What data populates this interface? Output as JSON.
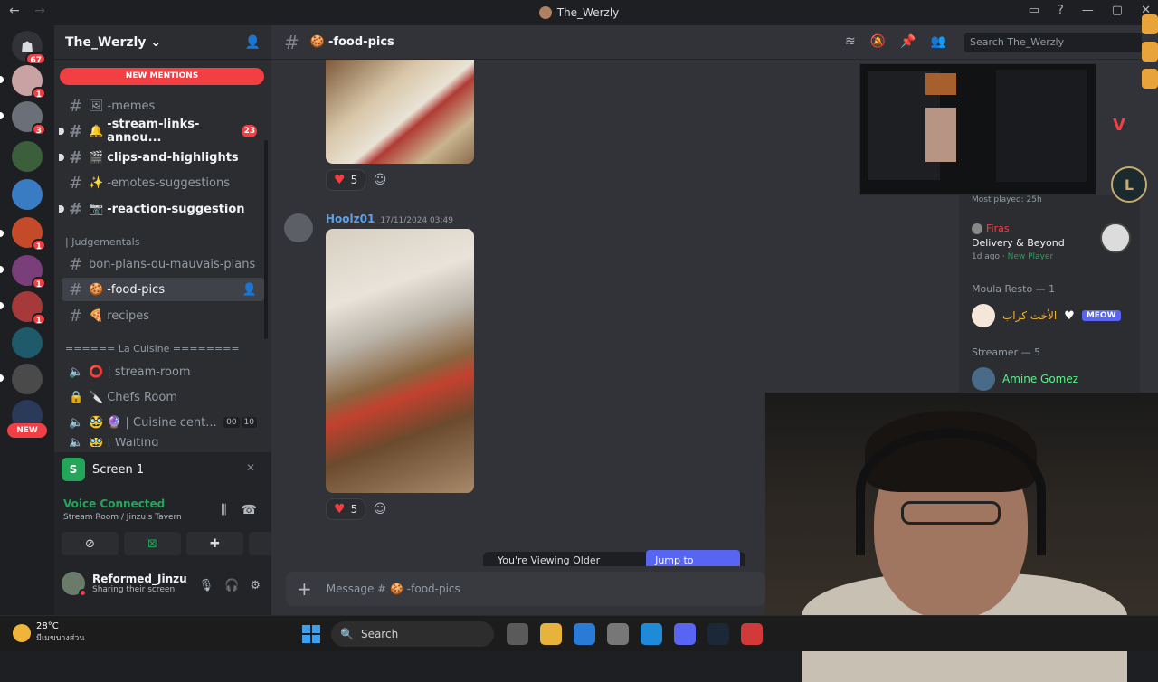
{
  "window": {
    "title": "The_Werzly",
    "back_icon": "back-arrow-icon",
    "forward_icon": "forward-arrow-icon"
  },
  "servers": {
    "home_badge": "67",
    "badges": [
      "1",
      "3",
      "1",
      "1",
      "1",
      "1"
    ],
    "new_label": "NEW"
  },
  "guild": {
    "name": "The_Werzly",
    "new_mentions": "NEW MENTIONS"
  },
  "channels": [
    {
      "name": "-memes",
      "emoji": "🖼"
    },
    {
      "name": "-stream-links-annou...",
      "emoji": "🔔",
      "badge": "23"
    },
    {
      "name": "clips-and-highlights",
      "emoji": "🎬"
    },
    {
      "name": "-emotes-suggestions",
      "emoji": "✨"
    },
    {
      "name": "-reaction-suggestion",
      "emoji": "📷"
    },
    {
      "name": "bon-plans-ou-mauvais-plans",
      "emoji": ""
    },
    {
      "name": "-food-pics",
      "emoji": "🍪"
    },
    {
      "name": "recipes",
      "emoji": "🍕"
    },
    {
      "name": "stream-room",
      "emoji": "⭕ |"
    },
    {
      "name": "Chefs Room",
      "emoji": "🔪"
    },
    {
      "name": "| Cuisine cent...",
      "emoji": "🥸 🔮",
      "c1": "00",
      "c2": "10"
    },
    {
      "name": "| Waiting",
      "emoji": "🥸"
    }
  ],
  "categories": {
    "judgements": "| Judgementals",
    "cuisine": "====== La Cuisine ========"
  },
  "panel": {
    "screen_label": "Screen 1",
    "voice_status": "Voice Connected",
    "voice_location": "Stream Room / Jinzu's Tavern",
    "username": "Reformed_Jinzu",
    "user_status": "Sharing their screen"
  },
  "channel_header": {
    "name": "-food-pics",
    "search_placeholder": "Search The_Werzly"
  },
  "messages": {
    "reaction_count_1": "5",
    "author": "Hoolz01",
    "timestamp": "17/11/2024 03:49",
    "reaction_count_2": "5",
    "older_text": "You're Viewing Older Messages",
    "jump_label": "Jump to Present",
    "composer_placeholder": "Message # 🍪 -food-pics"
  },
  "members": {
    "most_played": "Most played: 25h",
    "firas_name": "Firas",
    "firas_activity": "Delivery & Beyond",
    "firas_ago": "1d ago",
    "firas_tag": "New Player",
    "moula_section": "Moula Resto — 1",
    "moula_member": "الأخت كراب",
    "moula_tag": "MEOW",
    "streamer_section": "Streamer — 5",
    "streamer_member": "Amine Gomez"
  },
  "taskbar": {
    "temp": "28°C",
    "weather_desc": "มีเมฆบางส่วน",
    "search_label": "Search"
  }
}
